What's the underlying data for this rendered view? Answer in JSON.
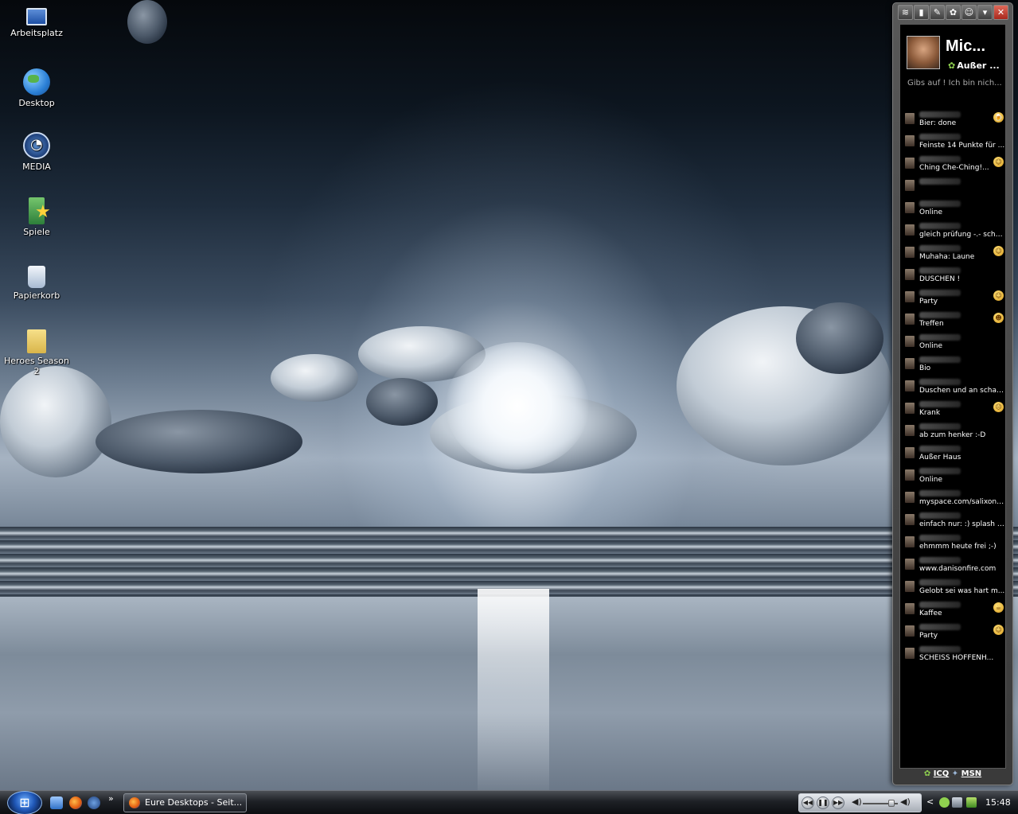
{
  "desktop": {
    "icons": [
      {
        "label": "Arbeitsplatz",
        "icon": "computer-icon"
      },
      {
        "label": "Desktop",
        "icon": "desktop-globe-icon"
      },
      {
        "label": "MEDIA",
        "icon": "media-center-icon"
      },
      {
        "label": "Spiele",
        "icon": "games-star-icon"
      },
      {
        "label": "Papierkorb",
        "icon": "recycle-bin-icon"
      },
      {
        "label": "Heroes Season 2",
        "icon": "folder-icon"
      }
    ]
  },
  "messenger": {
    "toolbar": {
      "buttons": [
        "≋",
        "▮",
        "✎",
        "✿",
        "☺",
        "▾",
        "✕"
      ]
    },
    "profile": {
      "name": "Mic...",
      "status": "Außer ...",
      "message": "Gibs auf ! Ich bin nich..."
    },
    "contacts": [
      {
        "message": "Bier: done",
        "emoticon": "beer"
      },
      {
        "message": "Feinste 14 Punkte für ...",
        "emoticon": ""
      },
      {
        "message": "Ching Che-Ching!...",
        "emoticon": "smile"
      },
      {
        "message": "",
        "emoticon": ""
      },
      {
        "message": "Online",
        "emoticon": ""
      },
      {
        "message": "gleich prüfung -.- schat...",
        "emoticon": ""
      },
      {
        "message": "Muhaha: Laune",
        "emoticon": "smile"
      },
      {
        "message": "DUSCHEN !",
        "emoticon": ""
      },
      {
        "message": "Party",
        "emoticon": "smile"
      },
      {
        "message": "Treffen",
        "emoticon": "people"
      },
      {
        "message": "Online",
        "emoticon": ""
      },
      {
        "message": "Bio",
        "emoticon": ""
      },
      {
        "message": "Duschen und an schatz...",
        "emoticon": ""
      },
      {
        "message": "Krank",
        "emoticon": "sick"
      },
      {
        "message": "ab zum henker :-D",
        "emoticon": ""
      },
      {
        "message": "Außer Haus",
        "emoticon": ""
      },
      {
        "message": "Online",
        "emoticon": ""
      },
      {
        "message": "myspace.com/salixonline",
        "emoticon": ""
      },
      {
        "message": "einfach nur: :) splash 2...",
        "emoticon": ""
      },
      {
        "message": "ehmmm heute frei ;-)",
        "emoticon": ""
      },
      {
        "message": "www.danisonfire.com",
        "emoticon": ""
      },
      {
        "message": "Gelobt sei was hart m...",
        "emoticon": ""
      },
      {
        "message": "Kaffee",
        "emoticon": "coffee"
      },
      {
        "message": "Party",
        "emoticon": "smile"
      },
      {
        "message": "SCHEISS HOFFENH...",
        "emoticon": ""
      }
    ],
    "footer": {
      "icq": "ICQ",
      "msn": "MSN"
    }
  },
  "taskbar": {
    "start_glyph": "⊞",
    "quicklaunch_more": "»",
    "task_label": "Eure Desktops - Seit...",
    "media_prev": "◀◀",
    "media_pause": "❚❚",
    "media_next": "▶▶",
    "volume_glyph": "◀)",
    "tray_arrow": "<",
    "clock": "15:48"
  }
}
